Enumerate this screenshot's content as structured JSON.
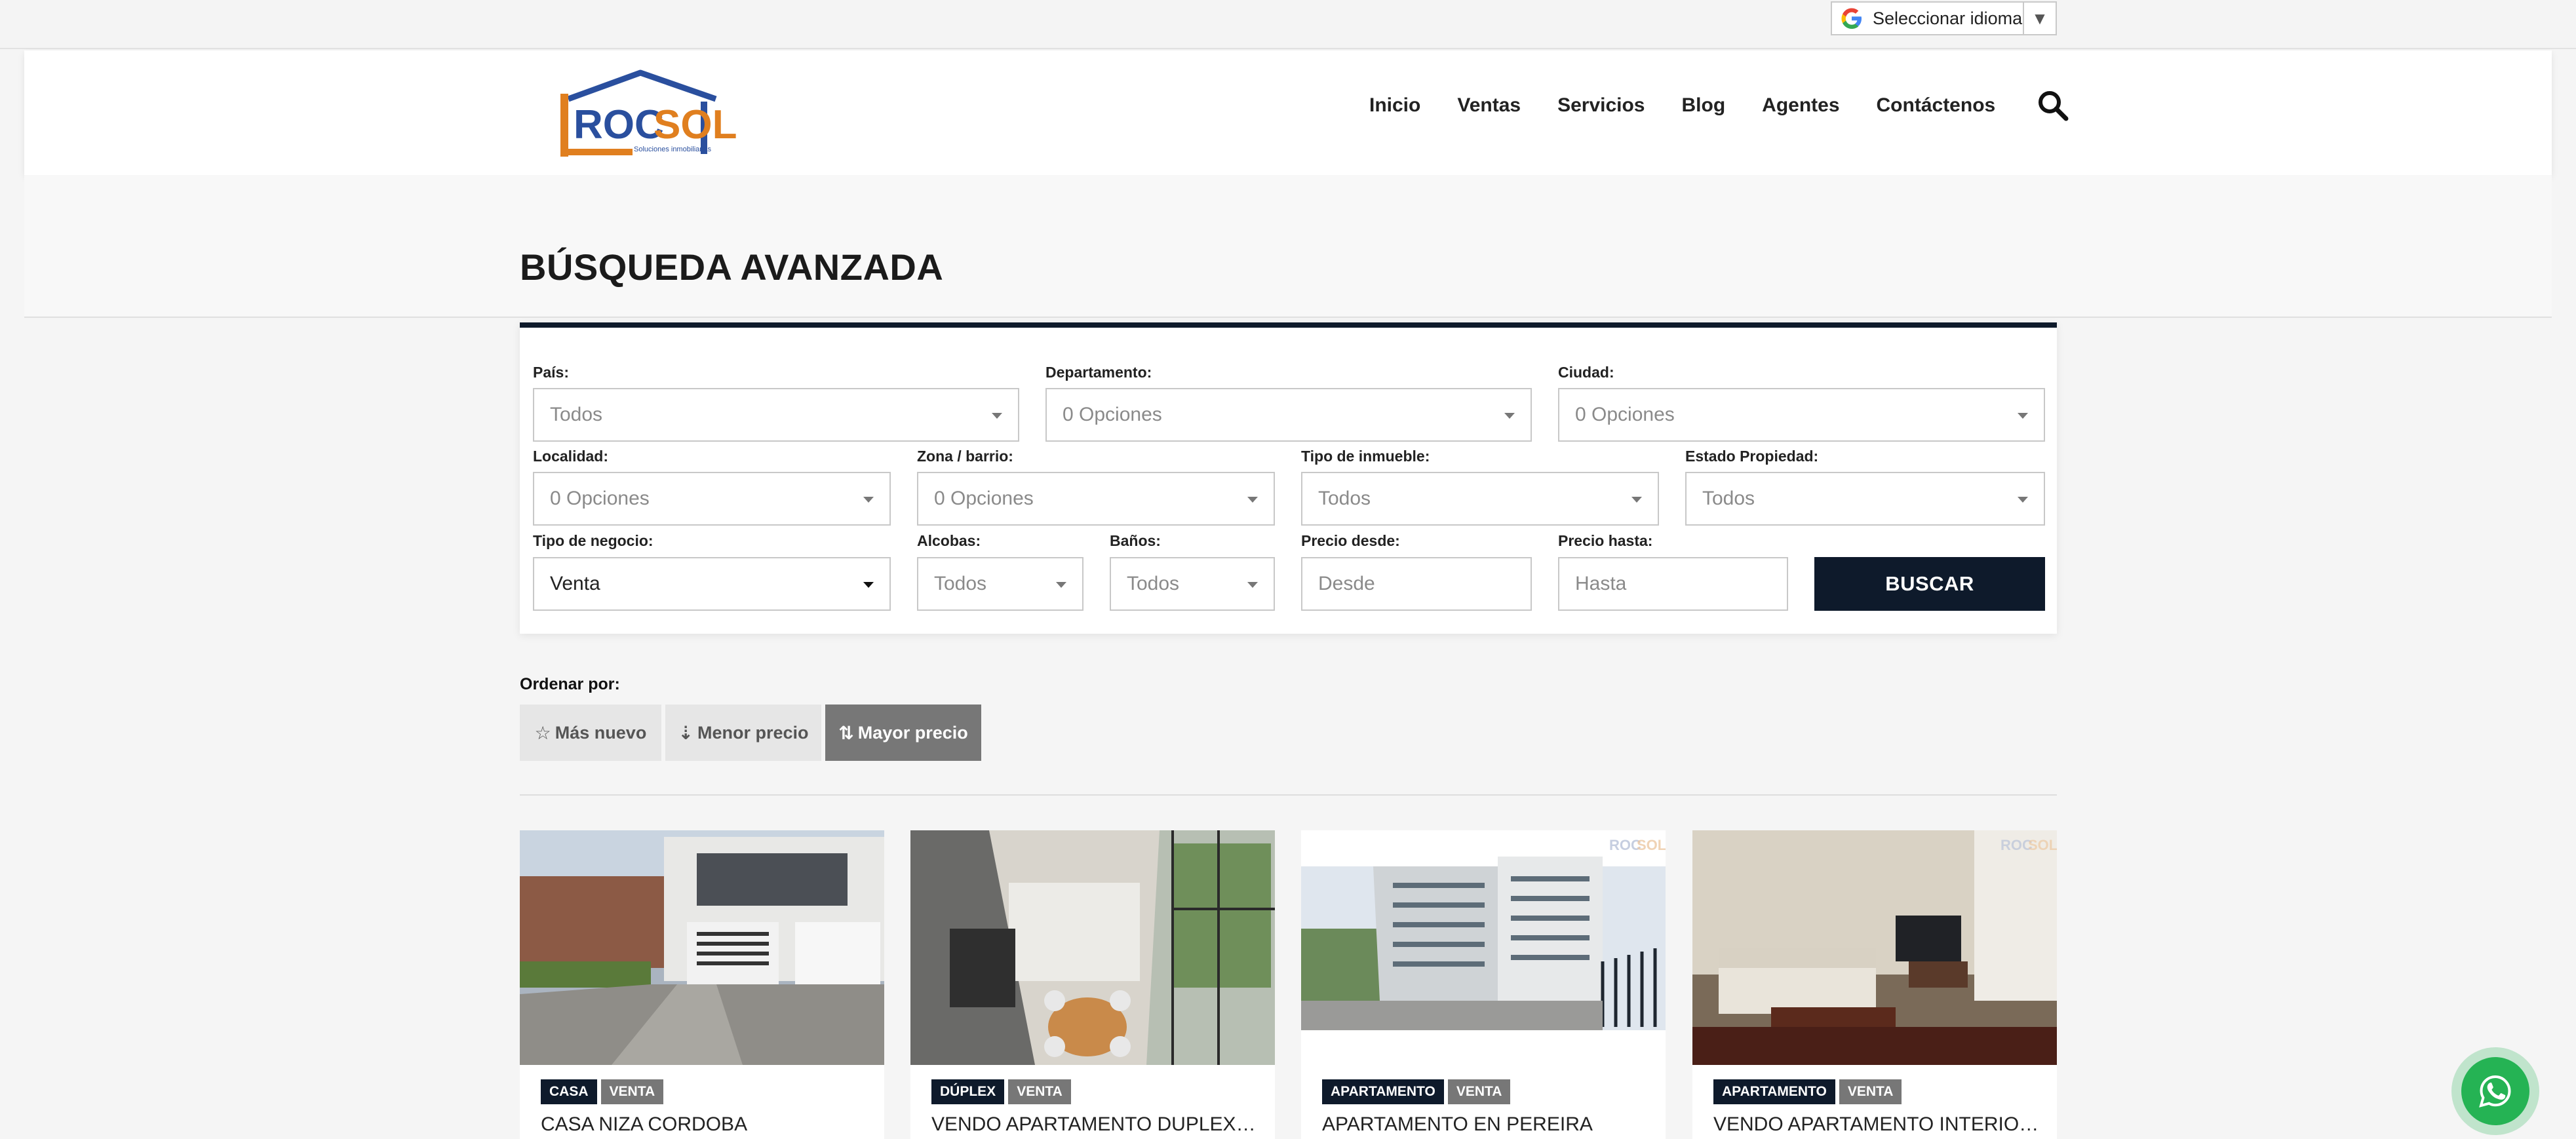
{
  "language": {
    "label": "Seleccionar idioma",
    "arrow": "▼"
  },
  "brand": {
    "logo_text_1": "ROC",
    "logo_text_2": "SOL",
    "logo_tagline": "Soluciones inmobiliarias"
  },
  "nav": {
    "items": [
      "Inicio",
      "Ventas",
      "Servicios",
      "Blog",
      "Agentes",
      "Contáctenos"
    ]
  },
  "page": {
    "title": "BÚSQUEDA AVANZADA"
  },
  "search": {
    "pais": {
      "label": "País:",
      "value": "Todos"
    },
    "departamento": {
      "label": "Departamento:",
      "value": "0 Opciones"
    },
    "ciudad": {
      "label": "Ciudad:",
      "value": "0 Opciones"
    },
    "localidad": {
      "label": "Localidad:",
      "value": "0 Opciones"
    },
    "zona": {
      "label": "Zona / barrio:",
      "value": "0 Opciones"
    },
    "tipo_inmueble": {
      "label": "Tipo de inmueble:",
      "value": "Todos"
    },
    "estado": {
      "label": "Estado Propiedad:",
      "value": "Todos"
    },
    "tipo_negocio": {
      "label": "Tipo de negocio:",
      "value": "Venta"
    },
    "alcobas": {
      "label": "Alcobas:",
      "value": "Todos"
    },
    "banos": {
      "label": "Baños:",
      "value": "Todos"
    },
    "precio_desde": {
      "label": "Precio desde:",
      "placeholder": "Desde"
    },
    "precio_hasta": {
      "label": "Precio hasta:",
      "placeholder": "Hasta"
    },
    "submit": "BUSCAR"
  },
  "sort": {
    "label": "Ordenar por:",
    "options": [
      {
        "icon": "☆",
        "label": "Más nuevo",
        "active": false
      },
      {
        "icon": "⇣",
        "label": "Menor precio",
        "active": false
      },
      {
        "icon": "⇅",
        "label": "Mayor precio",
        "active": true
      }
    ]
  },
  "listings": [
    {
      "type": "CASA",
      "business": "VENTA",
      "title": "CASA NIZA CORDOBA"
    },
    {
      "type": "DÚPLEX",
      "business": "VENTA",
      "title": "VENDO APARTAMENTO DUPLEX R..."
    },
    {
      "type": "APARTAMENTO",
      "business": "VENTA",
      "title": "APARTAMENTO EN PEREIRA"
    },
    {
      "type": "APARTAMENTO",
      "business": "VENTA",
      "title": "VENDO APARTAMENTO INTERIOR ..."
    }
  ],
  "colors": {
    "navy": "#0e1a2b",
    "gray_tag": "#777777",
    "whatsapp": "#25b354",
    "logo_blue": "#2a4f9e",
    "logo_orange": "#e07f1f"
  }
}
